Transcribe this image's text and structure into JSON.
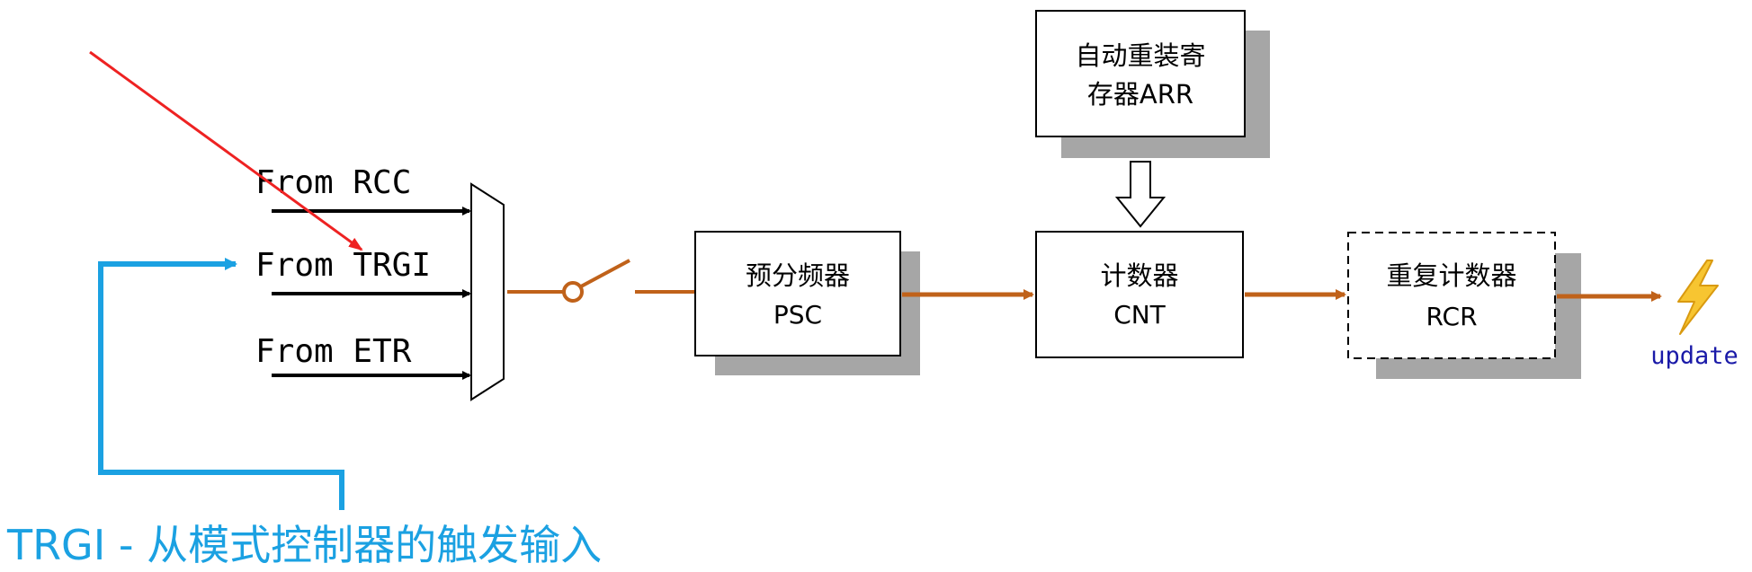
{
  "inputs": {
    "rcc": "From RCC",
    "trgi": "From TRGI",
    "etr": "From ETR"
  },
  "blocks": {
    "arr_line1": "自动重装寄",
    "arr_line2": "存器ARR",
    "psc_line1": "预分频器",
    "psc_line2": "PSC",
    "cnt_line1": "计数器",
    "cnt_line2": "CNT",
    "rcr_line1": "重复计数器",
    "rcr_line2": "RCR"
  },
  "output": {
    "label": "update"
  },
  "caption": "TRGI - 从模式控制器的触发输入",
  "colors": {
    "signal": "#c0621a",
    "callout": "#1ba1e2",
    "pointer": "#ee2222",
    "shadow": "#a6a6a6",
    "update_text": "#1a1aa8",
    "bolt_fill": "#f7c531",
    "bolt_stroke": "#d99a10"
  },
  "icons": {
    "update": "lightning-bolt-icon"
  }
}
